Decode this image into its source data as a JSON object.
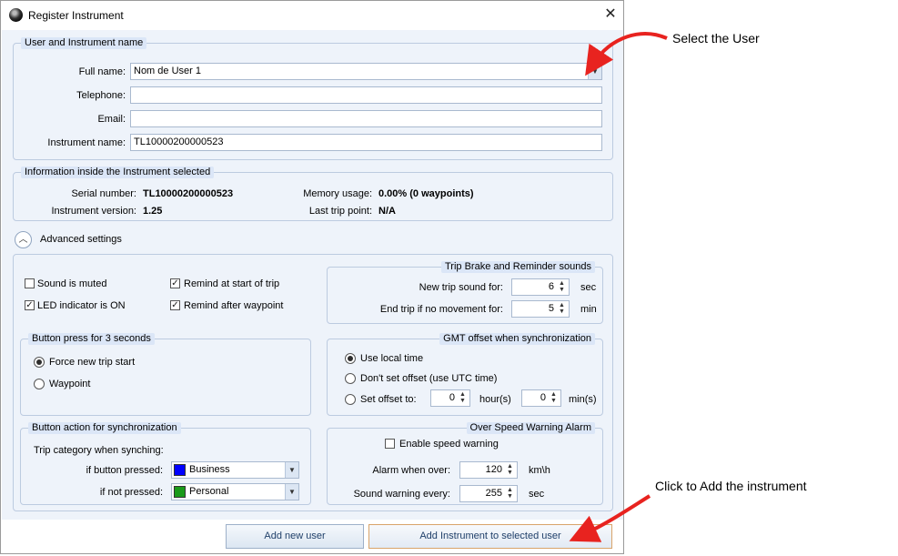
{
  "window": {
    "title": "Register Instrument"
  },
  "user_group": {
    "title": "User and Instrument name",
    "full_name_label": "Full name:",
    "full_name_value": "Nom de User 1",
    "telephone_label": "Telephone:",
    "telephone_value": "",
    "email_label": "Email:",
    "email_value": "",
    "instrument_name_label": "Instrument name:",
    "instrument_name_value": "TL10000200000523"
  },
  "info_group": {
    "title": "Information inside the Instrument selected",
    "serial_label": "Serial number:",
    "serial_value": "TL10000200000523",
    "version_label": "Instrument version:",
    "version_value": "1.25",
    "memory_label": "Memory usage:",
    "memory_value": "0.00% (0 waypoints)",
    "last_trip_label": "Last trip point:",
    "last_trip_value": "N/A"
  },
  "advanced": {
    "label": "Advanced settings",
    "sound_muted": {
      "label": "Sound is muted",
      "checked": false
    },
    "led_on": {
      "label": "LED indicator is ON",
      "checked": true
    },
    "remind_start": {
      "label": "Remind at start of trip",
      "checked": true
    },
    "remind_waypoint": {
      "label": "Remind after waypoint",
      "checked": true
    }
  },
  "trip_sounds": {
    "title": "Trip Brake and Reminder sounds",
    "new_trip_label": "New trip sound for:",
    "new_trip_value": "6",
    "new_trip_unit": "sec",
    "end_trip_label": "End trip if no movement for:",
    "end_trip_value": "5",
    "end_trip_unit": "min"
  },
  "button_press": {
    "title": "Button press for 3 seconds",
    "force_label": "Force new trip start",
    "waypoint_label": "Waypoint",
    "selected": "force"
  },
  "gmt": {
    "title": "GMT offset when synchronization",
    "local_label": "Use local time",
    "utc_label": "Don't set offset (use UTC time)",
    "set_label": "Set offset to:",
    "hours_value": "0",
    "hours_unit": "hour(s)",
    "mins_value": "0",
    "mins_unit": "min(s)",
    "selected": "local"
  },
  "sync": {
    "title": "Button action for synchronization",
    "trip_category_label": "Trip category when synching:",
    "pressed_label": "if button pressed:",
    "pressed_value": "Business",
    "pressed_color": "#0000ff",
    "not_pressed_label": "if not pressed:",
    "not_pressed_value": "Personal",
    "not_pressed_color": "#1a9a1a"
  },
  "overspeed": {
    "title": "Over Speed Warning Alarm",
    "enable_label": "Enable speed warning",
    "enable_checked": false,
    "alarm_label": "Alarm when over:",
    "alarm_value": "120",
    "alarm_unit": "km\\h",
    "sound_label": "Sound warning every:",
    "sound_value": "255",
    "sound_unit": "sec"
  },
  "footer": {
    "add_user_label": "Add new user",
    "add_instrument_label": "Add Instrument to selected user"
  },
  "annotations": {
    "select_user": "Select the User",
    "add_instrument": "Click to Add the instrument",
    "arrow_color": "#e8231f"
  }
}
